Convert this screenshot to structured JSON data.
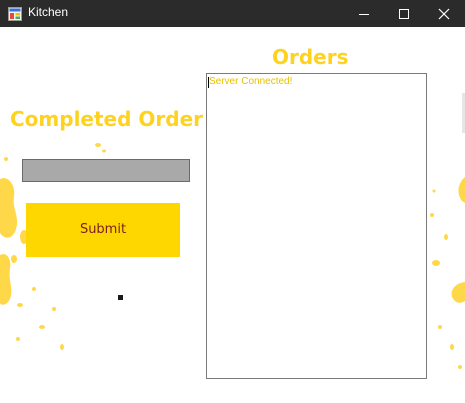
{
  "window": {
    "title": "Kitchen",
    "icons": {
      "app": "window-app-icon",
      "minimize": "minimize-icon",
      "maximize": "maximize-icon",
      "close": "close-icon"
    }
  },
  "left_panel": {
    "heading": "Completed Order",
    "order_input": {
      "value": "",
      "placeholder": ""
    },
    "submit_label": "Submit"
  },
  "right_panel": {
    "heading": "Orders",
    "lines": [
      "Server Connected!"
    ]
  },
  "colors": {
    "accent": "#ffd21f",
    "button_bg": "#ffd700",
    "button_text": "#7a1f1f",
    "input_bg": "#a9a9a9",
    "titlebar_bg": "#2b2b2b"
  }
}
